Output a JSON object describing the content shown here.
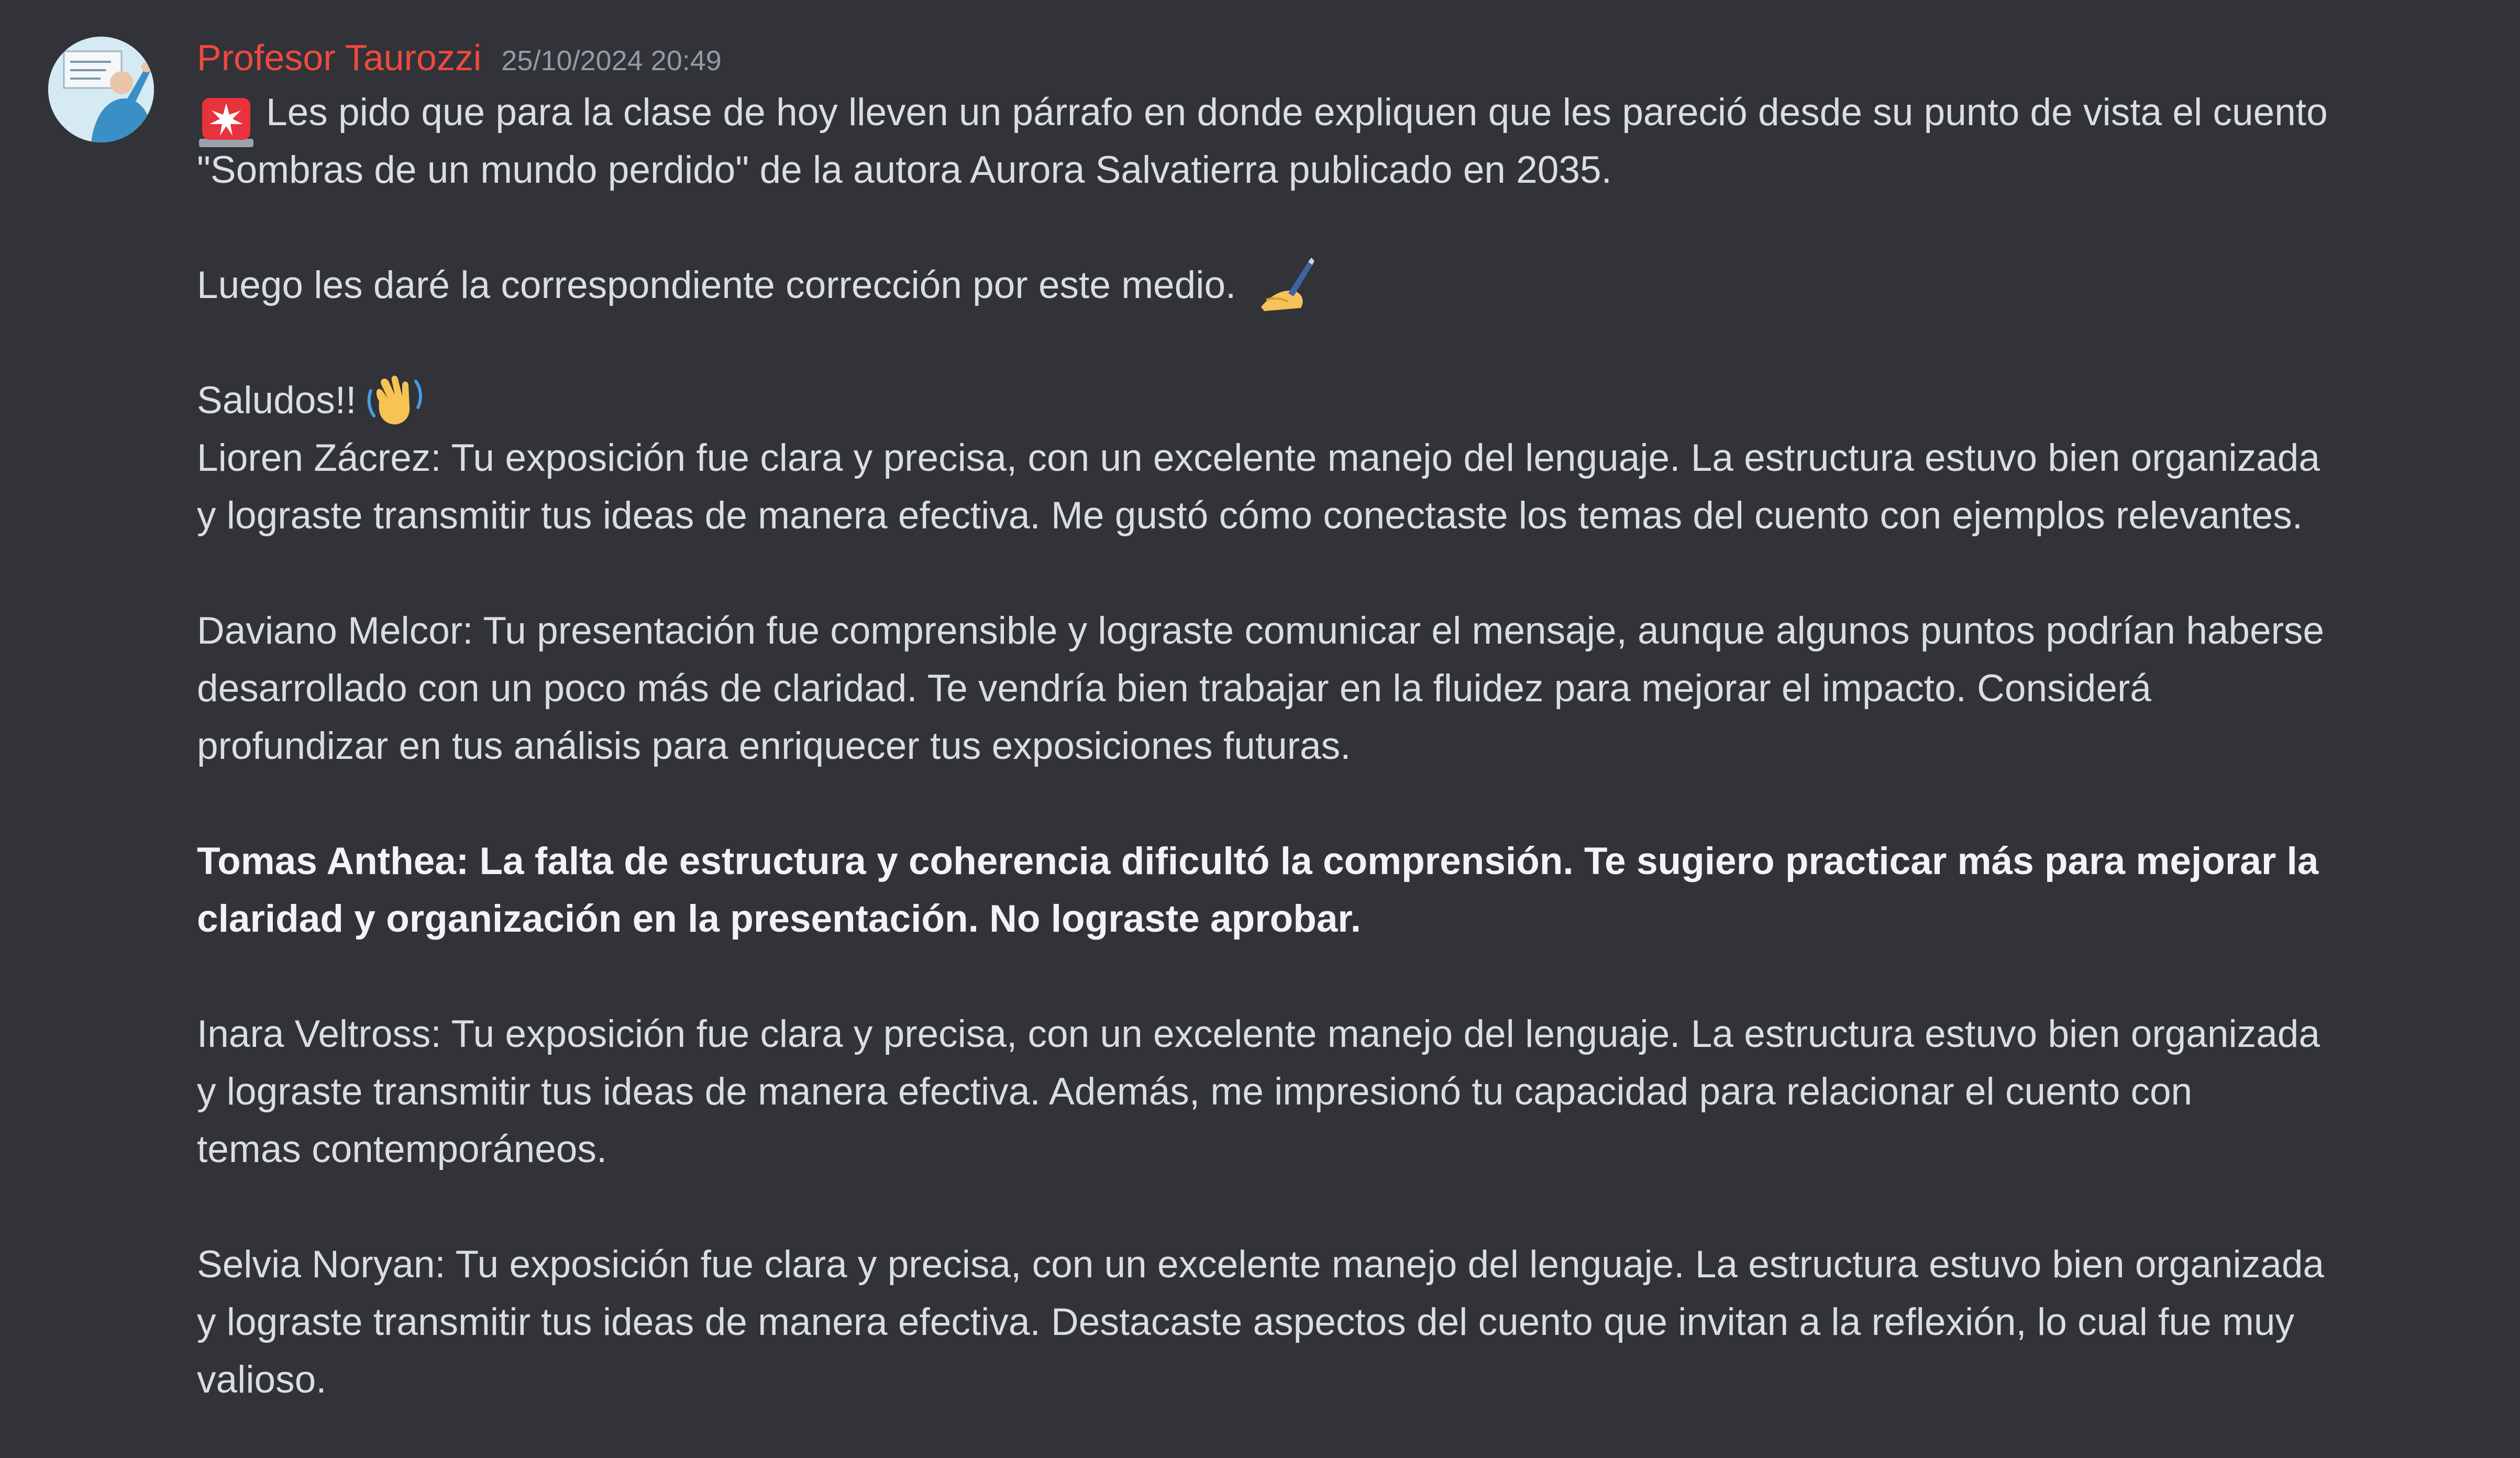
{
  "message": {
    "author": "Profesor Taurozzi",
    "timestamp": "25/10/2024 20:49",
    "paragraph1": {
      "emoji": "rotating-light-emoji",
      "line1": "Les pido que para la clase de hoy lleven un párrafo en donde expliquen que les pareció desde su punto de vista el cuento",
      "line2": "\"Sombras de un mundo perdido\" de la autora Aurora Salvatierra publicado en 2035."
    },
    "paragraph2": {
      "text": "Luego les daré la correspondiente corrección por este medio.",
      "emoji": "writing-hand-emoji"
    },
    "paragraph3": {
      "text": "Saludos!!",
      "emoji": "waving-hand-emoji"
    },
    "feedback": [
      {
        "lines": [
          "Lioren Zácrez: Tu exposición fue clara y precisa, con un excelente manejo del lenguaje. La estructura estuvo bien organizada",
          "y lograste transmitir tus ideas de manera efectiva. Me gustó cómo conectaste los temas del cuento con ejemplos relevantes."
        ]
      },
      {
        "lines": [
          "Daviano Melcor: Tu presentación fue comprensible y lograste comunicar el mensaje, aunque algunos puntos podrían haberse",
          "desarrollado con un poco más de claridad. Te vendría bien trabajar en la fluidez para mejorar el impacto. Considerá",
          "profundizar en tus análisis para enriquecer tus exposiciones futuras."
        ]
      },
      {
        "bold": true,
        "lines": [
          "Tomas Anthea: La falta de estructura y coherencia dificultó la comprensión. Te sugiero practicar más para mejorar la",
          "claridad y organización en la presentación. No lograste aprobar."
        ]
      },
      {
        "lines": [
          "Inara Veltross: Tu exposición fue clara y precisa, con un excelente manejo del lenguaje. La estructura estuvo bien organizada",
          "y lograste transmitir tus ideas de manera efectiva. Además, me impresionó tu capacidad para relacionar el cuento con",
          "temas contemporáneos."
        ]
      },
      {
        "lines": [
          "Selvia Noryan: Tu exposición fue clara y precisa, con un excelente manejo del lenguaje. La estructura estuvo bien organizada",
          "y lograste transmitir tus ideas de manera efectiva. Destacaste aspectos del cuento que invitan a la reflexión, lo cual fue muy",
          "valioso."
        ]
      }
    ]
  },
  "colors": {
    "background": "#313338",
    "author": "#f0493f",
    "timestamp": "#949ba4",
    "text": "#dbdee1",
    "bold_text": "#f2f3f5"
  }
}
